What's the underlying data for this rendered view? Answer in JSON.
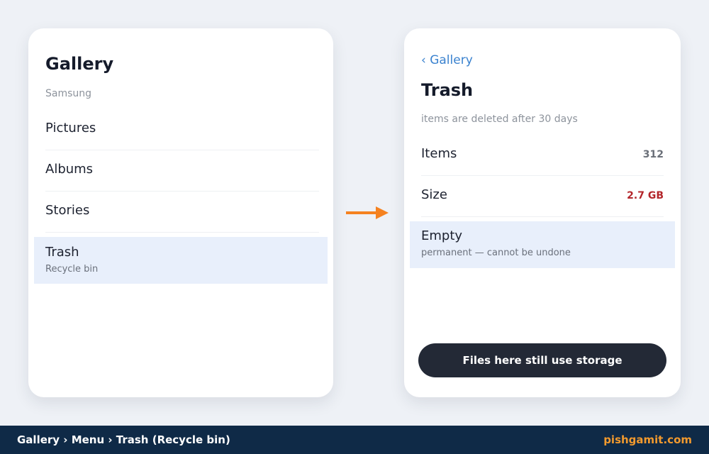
{
  "left_panel": {
    "title": "Gallery",
    "subtitle": "Samsung",
    "menu_items": [
      {
        "label": "Pictures"
      },
      {
        "label": "Albums"
      },
      {
        "label": "Stories"
      },
      {
        "label": "Trash",
        "sublabel": "Recycle bin",
        "selected": true
      }
    ]
  },
  "right_panel": {
    "back_label": "‹ Gallery",
    "title": "Trash",
    "subtitle": "items are deleted after 30 days",
    "rows": [
      {
        "label": "Items",
        "value": "312"
      },
      {
        "label": "Size",
        "value": "2.7 GB",
        "value_color": "#b3262b"
      }
    ],
    "action": {
      "label": "Empty",
      "sublabel": "permanent — cannot be undone"
    },
    "button_label": "Files here still use storage"
  },
  "footer": {
    "breadcrumb": "Gallery › Menu › Trash (Recycle bin)",
    "brand": "pishgamit.com"
  },
  "colors": {
    "accent": "#3a82cf",
    "arrow": "#f58220",
    "highlight": "#e8effb",
    "danger": "#b3262b",
    "footer_bg": "#0f2a47",
    "brand": "#f29a2e"
  },
  "icons": {
    "flow_arrow": "arrow-right-icon"
  }
}
